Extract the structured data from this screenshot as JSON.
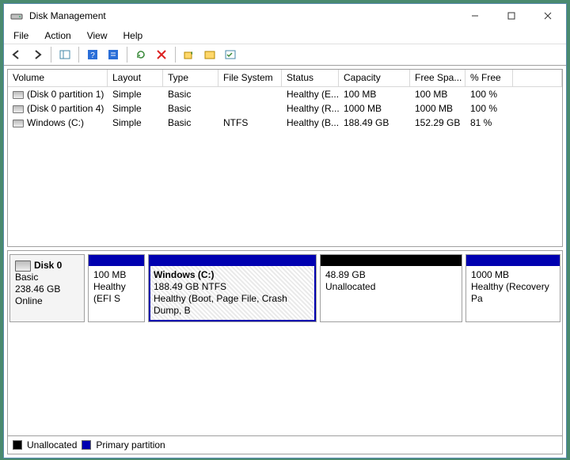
{
  "window": {
    "title": "Disk Management"
  },
  "menu": {
    "file": "File",
    "action": "Action",
    "view": "View",
    "help": "Help"
  },
  "columns": {
    "volume": "Volume",
    "layout": "Layout",
    "type": "Type",
    "filesystem": "File System",
    "status": "Status",
    "capacity": "Capacity",
    "freespace": "Free Spa...",
    "pctfree": "% Free"
  },
  "volumes": [
    {
      "name": "(Disk 0 partition 1)",
      "layout": "Simple",
      "type": "Basic",
      "fs": "",
      "status": "Healthy (E...",
      "capacity": "100 MB",
      "free": "100 MB",
      "pct": "100 %"
    },
    {
      "name": "(Disk 0 partition 4)",
      "layout": "Simple",
      "type": "Basic",
      "fs": "",
      "status": "Healthy (R...",
      "capacity": "1000 MB",
      "free": "1000 MB",
      "pct": "100 %"
    },
    {
      "name": "Windows (C:)",
      "layout": "Simple",
      "type": "Basic",
      "fs": "NTFS",
      "status": "Healthy (B...",
      "capacity": "188.49 GB",
      "free": "152.29 GB",
      "pct": "81 %"
    }
  ],
  "disk": {
    "label": "Disk 0",
    "type": "Basic",
    "size": "238.46 GB",
    "state": "Online",
    "partitions": [
      {
        "kind": "primary",
        "title": "",
        "sub": "100 MB",
        "status": "Healthy (EFI S",
        "selected": false
      },
      {
        "kind": "primary",
        "title": "Windows  (C:)",
        "sub": "188.49 GB NTFS",
        "status": "Healthy (Boot, Page File, Crash Dump, B",
        "selected": true
      },
      {
        "kind": "unalloc",
        "title": "",
        "sub": "48.89 GB",
        "status": "Unallocated",
        "selected": false
      },
      {
        "kind": "primary",
        "title": "",
        "sub": "1000 MB",
        "status": "Healthy (Recovery Pa",
        "selected": false
      }
    ]
  },
  "legend": {
    "unallocated": "Unallocated",
    "primary": "Primary partition"
  }
}
